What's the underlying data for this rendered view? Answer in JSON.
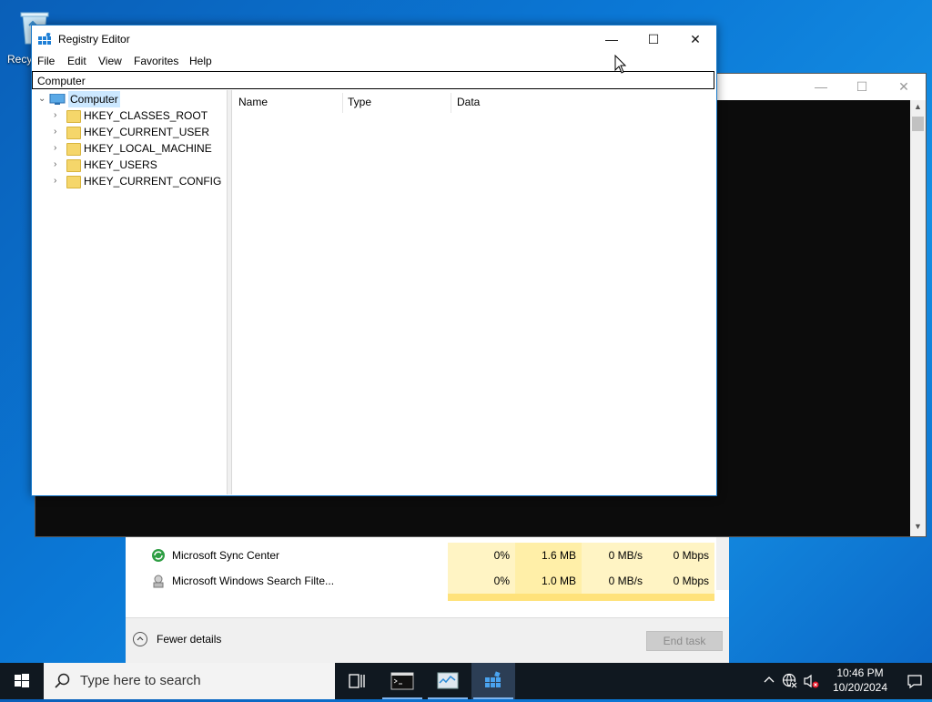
{
  "desktop": {
    "recycle_bin_label": "Recy"
  },
  "regedit": {
    "title": "Registry Editor",
    "window_controls": {
      "minimize": "—",
      "maximize": "☐",
      "close": "✕"
    },
    "menu": [
      "File",
      "Edit",
      "View",
      "Favorites",
      "Help"
    ],
    "address": "Computer",
    "tree": {
      "root": "Computer",
      "children": [
        "HKEY_CLASSES_ROOT",
        "HKEY_CURRENT_USER",
        "HKEY_LOCAL_MACHINE",
        "HKEY_USERS",
        "HKEY_CURRENT_CONFIG"
      ]
    },
    "columns": [
      "Name",
      "Type",
      "Data"
    ]
  },
  "task_manager": {
    "rows": [
      {
        "name": "Microsoft Sync Center",
        "cpu": "0%",
        "memory": "1.6 MB",
        "disk": "0 MB/s",
        "network": "0 Mbps",
        "icon": "sync-center-icon"
      },
      {
        "name": "Microsoft Windows Search Filte...",
        "cpu": "0%",
        "memory": "1.0 MB",
        "disk": "0 MB/s",
        "network": "0 Mbps",
        "icon": "search-filter-icon"
      }
    ],
    "fewer_details": "Fewer details",
    "end_task": "End task"
  },
  "console": {
    "window_controls": {
      "minimize": "—",
      "maximize": "☐",
      "close": "✕"
    }
  },
  "taskbar": {
    "search_placeholder": "Type here to search",
    "time": "10:46 PM",
    "date": "10/20/2024"
  }
}
